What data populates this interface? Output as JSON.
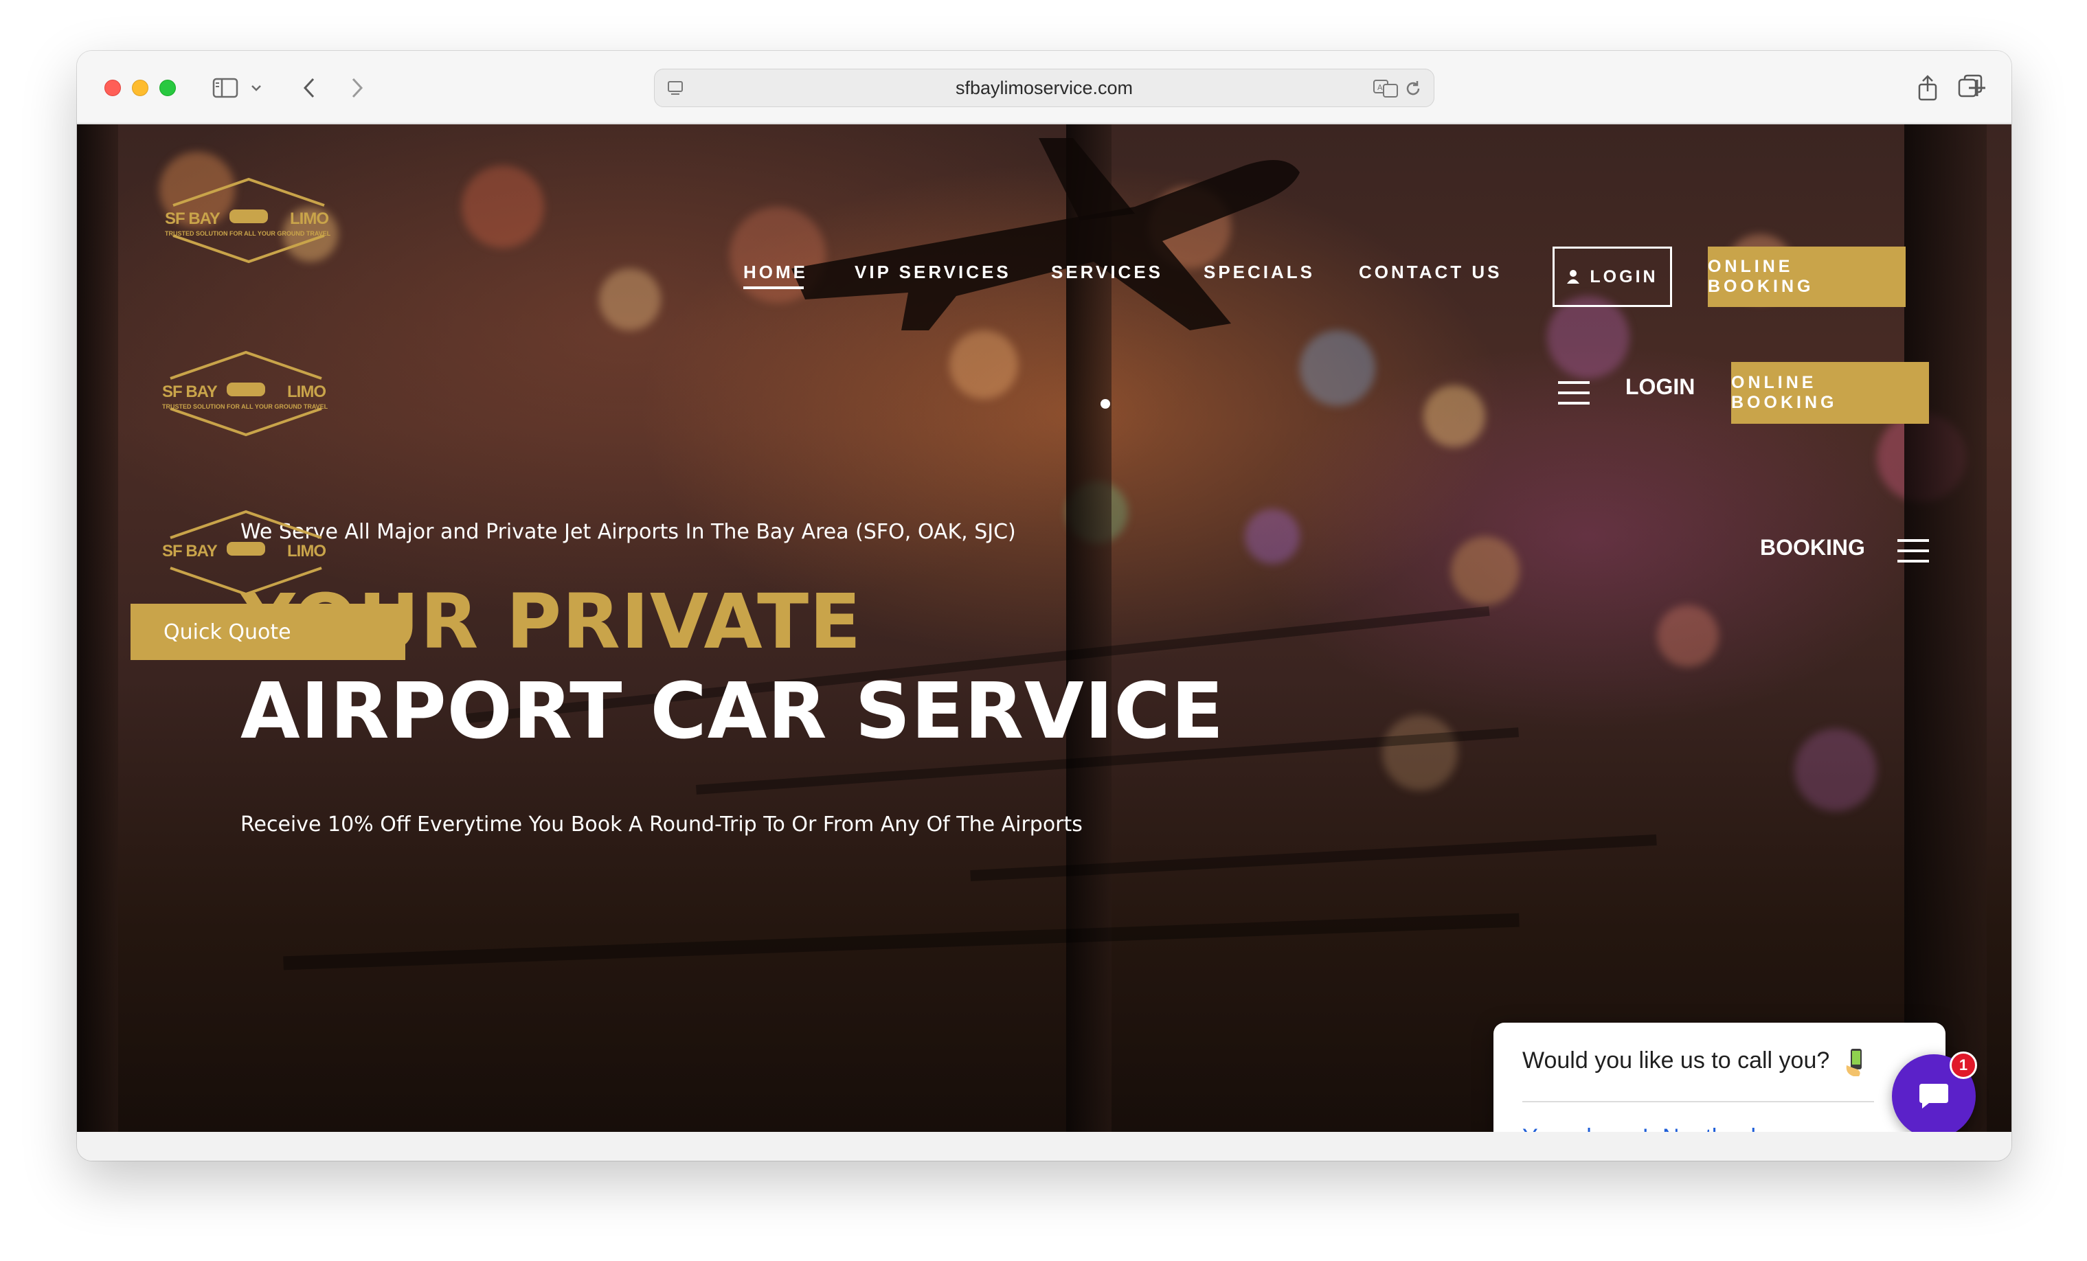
{
  "browser": {
    "url": "sfbaylimoservice.com"
  },
  "site": {
    "logo": {
      "brand_left": "SF BAY",
      "brand_right": "LIMO",
      "tagline": "TRUSTED SOLUTION FOR ALL YOUR GROUND TRAVEL"
    },
    "nav": {
      "items": [
        "HOME",
        "VIP SERVICES",
        "SERVICES",
        "SPECIALS",
        "CONTACT US"
      ],
      "active": "HOME",
      "login_label": "LOGIN",
      "booking_label": "ONLINE BOOKING"
    },
    "nav2": {
      "login_label": "LOGIN",
      "booking_label": "ONLINE BOOKING"
    },
    "nav3": {
      "booking_label": "BOOKING"
    },
    "quick_quote_label": "Quick Quote"
  },
  "hero": {
    "subtitle": "We Serve All Major and Private Jet Airports In The Bay Area (SFO, OAK, SJC)",
    "title_line1": "YOUR PRIVATE",
    "title_line2": "AIRPORT CAR SERVICE",
    "description": "Receive 10% Off Everytime You Book A Round-Trip To Or From Any Of The Airports"
  },
  "call_widget": {
    "question": "Would you like us to call you?",
    "yes_label": "Yes, please!",
    "no_label": "No, thanks.",
    "badge_count": "1"
  },
  "colors": {
    "accent_gold": "#c9a44a",
    "chat_purple": "#5b21c9",
    "link_blue": "#1e5ed8",
    "badge_red": "#e0192a"
  },
  "icons": [
    "sidebar-icon",
    "chevron-down-icon",
    "back-icon",
    "forward-icon",
    "site-icon",
    "translate-icon",
    "reload-icon",
    "share-icon",
    "new-tab-icon",
    "tabs-icon",
    "user-icon",
    "hamburger-icon",
    "phone-icon",
    "chat-icon"
  ]
}
